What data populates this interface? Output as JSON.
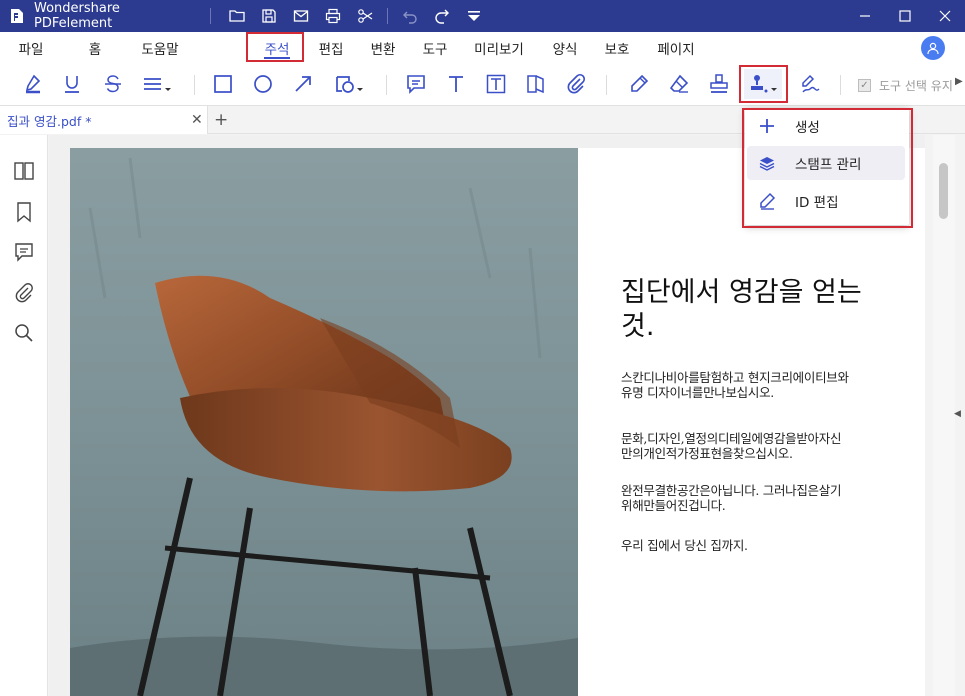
{
  "app": {
    "title": "Wondershare PDFelement"
  },
  "quick_access": [
    "folder-icon",
    "save-icon",
    "mail-icon",
    "print-icon",
    "scissors-icon",
    "undo-icon",
    "redo-icon",
    "customize-icon"
  ],
  "menu": {
    "items": [
      "파일",
      "홈",
      "도움말",
      "주석",
      "편집",
      "변환",
      "도구",
      "미리보기",
      "양식",
      "보호",
      "페이지"
    ],
    "active": "주석"
  },
  "toolbar": {
    "keep_tool_label": "도구 선택 유지"
  },
  "tab": {
    "name": "집과 영감.pdf *"
  },
  "stamp_menu": {
    "items": [
      {
        "label": "생성",
        "icon": "plus-icon"
      },
      {
        "label": "스탬프 관리",
        "icon": "layers-icon"
      },
      {
        "label": "ID 편집",
        "icon": "pencil-icon"
      }
    ]
  },
  "document": {
    "heading": "집단에서 영감을 얻는것.",
    "paragraphs": [
      "스칸디나비아를탐험하고 현지크리에이티브와유명 디자이너를만나보십시오.",
      "문화,디자인,열정의디테일에영감을받아자신만의개인적가정표현을찾으십시오.",
      "완전무결한공간은아닙니다. 그러나집은살기위해만들어진겁니다.",
      "우리 집에서 당신 집까지."
    ]
  },
  "colors": {
    "titlebar": "#2c3b8f",
    "accent": "#3a4fc8",
    "highlight": "#d32b36",
    "avatar": "#4a7cf1"
  }
}
